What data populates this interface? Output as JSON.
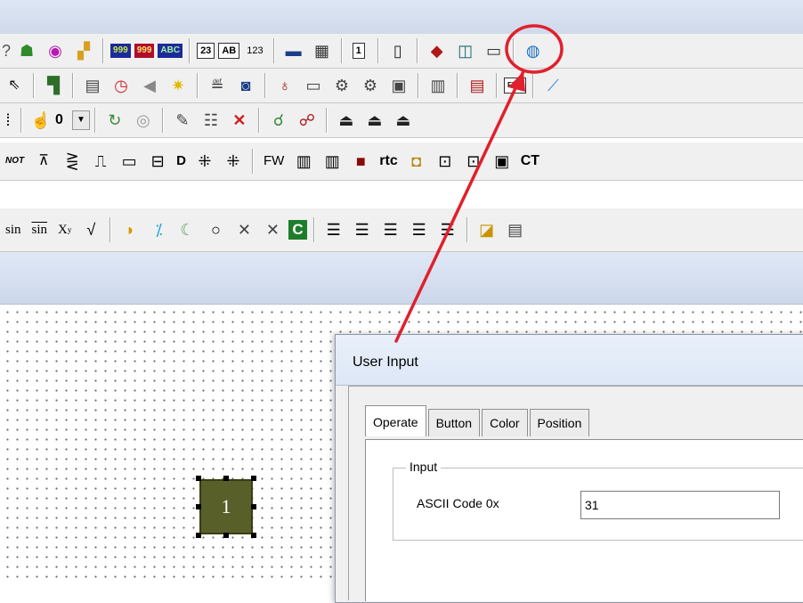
{
  "toolbar_row2": {
    "display_999_a": "999",
    "display_999_b": "999",
    "display_abc": "ABC",
    "box_23": "23",
    "box_ab": "AB",
    "num_123": "123",
    "user_input_button": "1"
  },
  "toolbar_row3": {
    "box_fm": "FMN"
  },
  "toolbar_row4": {
    "dropdown_value": "0"
  },
  "toolbar_row5": {
    "not_label": "NOT",
    "d_label": "D",
    "fw_label": "FW",
    "rtc_label": "rtc",
    "ct_label": "CT"
  },
  "toolbar_row6": {
    "sin_label": "sin",
    "sin_bar_label": "sin",
    "xy_label": "X",
    "xy_sup": "y",
    "c_label": "C"
  },
  "canvas": {
    "component_label": "1"
  },
  "dialog": {
    "title": "User Input",
    "tabs": [
      "Operate",
      "Button",
      "Color",
      "Position"
    ],
    "group_label": "Input",
    "field_label": "ASCII Code 0x",
    "field_value": "31"
  },
  "colors": {
    "highlight_circle": "#e0202c",
    "arrow": "#e0202c",
    "component_fill": "#585f28"
  }
}
